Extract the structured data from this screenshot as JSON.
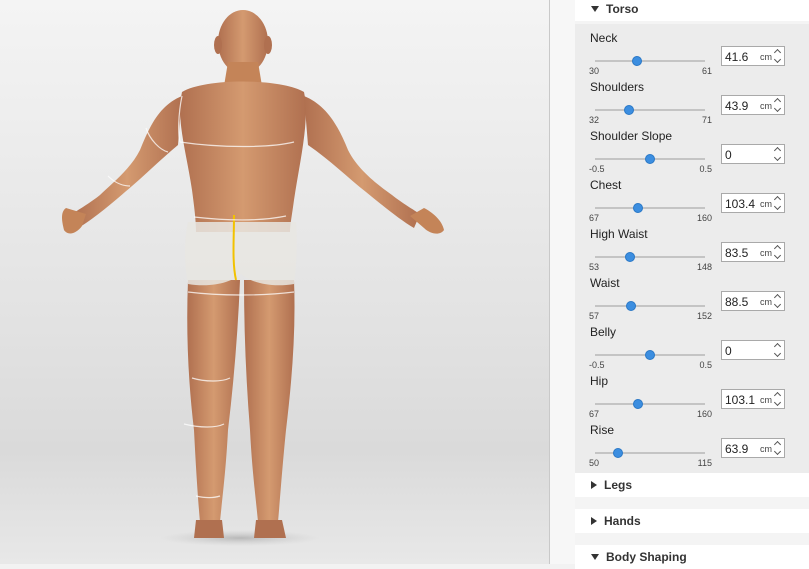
{
  "sections": {
    "torso": "Torso",
    "legs": "Legs",
    "hands": "Hands",
    "body_shaping": "Body Shaping"
  },
  "measurements": [
    {
      "label": "Neck",
      "value": "41.6",
      "unit": "cm",
      "min": "30",
      "max": "61",
      "slider_fraction": 0.38
    },
    {
      "label": "Shoulders",
      "value": "43.9",
      "unit": "cm",
      "min": "32",
      "max": "71",
      "slider_fraction": 0.31
    },
    {
      "label": "Shoulder Slope",
      "value": "0",
      "unit": "",
      "min": "-0.5",
      "max": "0.5",
      "slider_fraction": 0.5
    },
    {
      "label": "Chest",
      "value": "103.4",
      "unit": "cm",
      "min": "67",
      "max": "160",
      "slider_fraction": 0.39
    },
    {
      "label": "High Waist",
      "value": "83.5",
      "unit": "cm",
      "min": "53",
      "max": "148",
      "slider_fraction": 0.32
    },
    {
      "label": "Waist",
      "value": "88.5",
      "unit": "cm",
      "min": "57",
      "max": "152",
      "slider_fraction": 0.33
    },
    {
      "label": "Belly",
      "value": "0",
      "unit": "",
      "min": "-0.5",
      "max": "0.5",
      "slider_fraction": 0.5
    },
    {
      "label": "Hip",
      "value": "103.1",
      "unit": "cm",
      "min": "67",
      "max": "160",
      "slider_fraction": 0.39
    },
    {
      "label": "Rise",
      "value": "63.9",
      "unit": "cm",
      "min": "50",
      "max": "115",
      "slider_fraction": 0.21
    }
  ],
  "colors": {
    "accent": "#3c8ee0",
    "skin": "#c98b62",
    "underwear": "#e8e6e2"
  }
}
